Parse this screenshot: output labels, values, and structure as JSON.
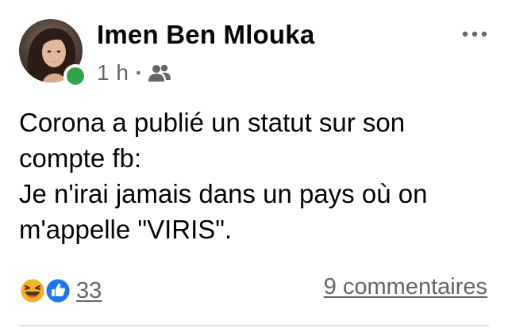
{
  "post": {
    "author": {
      "name": "Imen Ben Mlouka",
      "online": true
    },
    "meta": {
      "time": "1 h",
      "separator": "·",
      "audience_icon": "friends-icon"
    },
    "more_icon": "more-options-icon",
    "text_lines": [
      "Corona a publié un statut sur son",
      "compte fb:",
      "Je n'irai jamais dans un pays où on",
      "m'appelle \"VIRIS\"."
    ],
    "reactions": {
      "icons": [
        "haha-reaction-icon",
        "like-reaction-icon"
      ],
      "count": "33"
    },
    "comments_label": "9 commentaires"
  },
  "colors": {
    "text": "#050505",
    "secondary_text": "#65676b",
    "online": "#31a24c",
    "like_blue": "#1877f2",
    "haha_yellow": "#f7b125",
    "divider": "#dadde1"
  }
}
